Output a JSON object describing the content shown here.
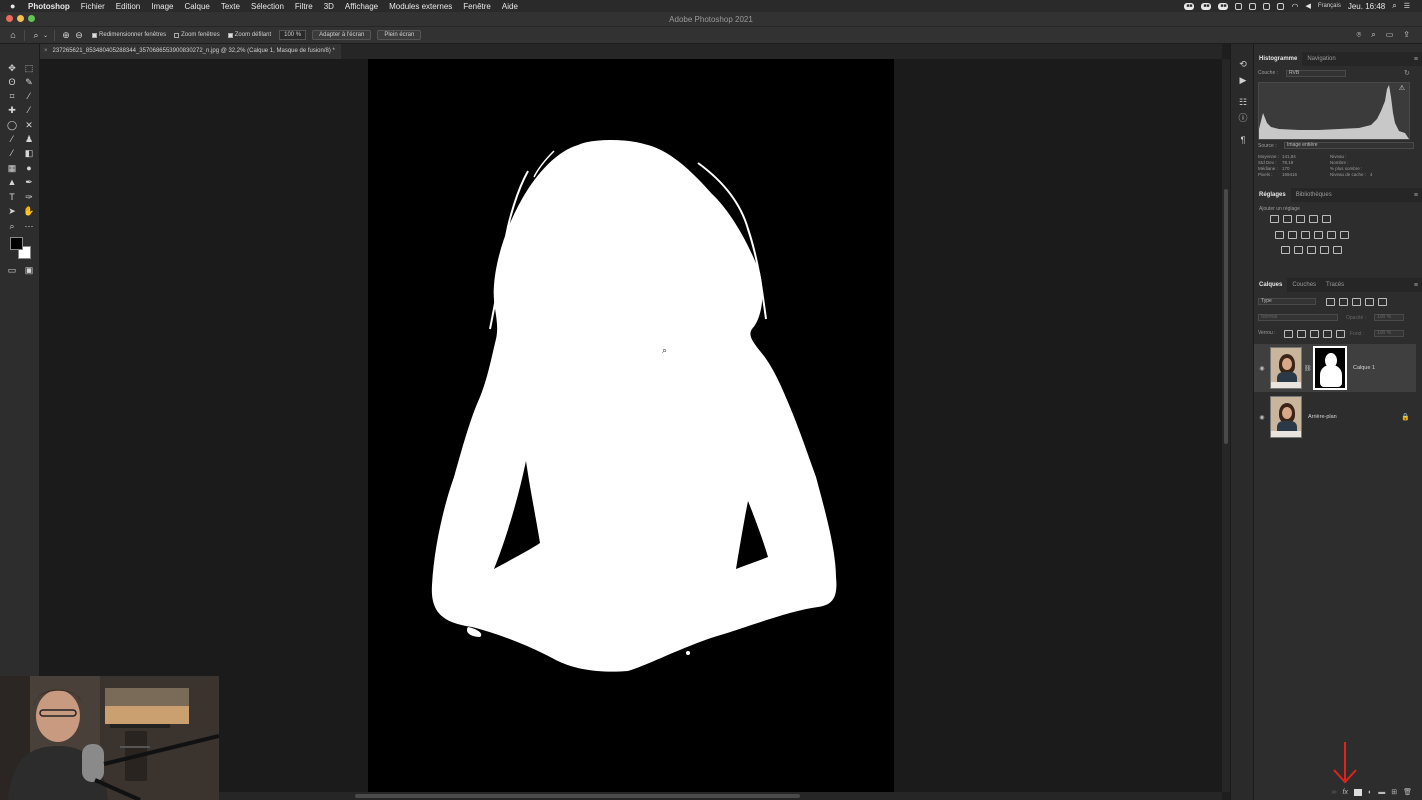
{
  "menubar": {
    "apple": "",
    "items": [
      "Photoshop",
      "Fichier",
      "Edition",
      "Image",
      "Calque",
      "Texte",
      "Sélection",
      "Filtre",
      "3D",
      "Affichage",
      "Modules externes",
      "Fenêtre",
      "Aide"
    ],
    "language": "Français",
    "clock": "Jeu. 16:48"
  },
  "window": {
    "title": "Adobe Photoshop 2021"
  },
  "options": {
    "redimensionner": "Redimensionner fenêtres",
    "zoom_fenetres": "Zoom fenêtres",
    "zoom_defilant": "Zoom défilant",
    "zoom_value": "100 %",
    "adapter": "Adapter à l'écran",
    "plein_ecran": "Plein écran"
  },
  "document": {
    "tab_title": "237265621_853480405288344_3570686553900830272_n.jpg @ 32,2% (Calque 1, Masque de fusion/8) *"
  },
  "histogram": {
    "tab_active": "Histogramme",
    "tab_other": "Navigation",
    "couche_label": "Couche :",
    "couche_value": "RVB",
    "source_label": "Source :",
    "source_value": "Image entière",
    "stats": [
      [
        "Moyenne :",
        "141,84",
        "Niveau :",
        ""
      ],
      [
        "Std Dev :",
        "78,19",
        "Nombre :",
        ""
      ],
      [
        "Médiane :",
        "170",
        "% plus sombre :",
        ""
      ],
      [
        "Pixels :",
        "169416",
        "Niveau de cache :",
        "4"
      ]
    ]
  },
  "adjustments": {
    "tab_active": "Réglages",
    "tab_other": "Bibliothèques",
    "hint": "Ajouter un réglage"
  },
  "layers": {
    "tabs": [
      "Calques",
      "Couches",
      "Tracés"
    ],
    "filter": "Type",
    "blend": "Normal",
    "opacity_label": "Opacité :",
    "opacity": "100 %",
    "lock_label": "Verrou :",
    "fill_label": "Fond :",
    "fill": "100 %",
    "items": [
      {
        "name": "Calque 1",
        "has_mask": true,
        "selected": true,
        "locked": false
      },
      {
        "name": "Arrière-plan",
        "has_mask": false,
        "selected": false,
        "locked": true
      }
    ],
    "bottom_icons": [
      "link-icon",
      "fx-icon",
      "add-mask-icon",
      "adjustment-icon",
      "folder-icon",
      "new-layer-icon",
      "trash-icon"
    ],
    "fx_label": "fx"
  },
  "colors": {
    "accent_arrow": "#e0231c",
    "canvas": "#000000",
    "panel": "#2d2d2d"
  }
}
